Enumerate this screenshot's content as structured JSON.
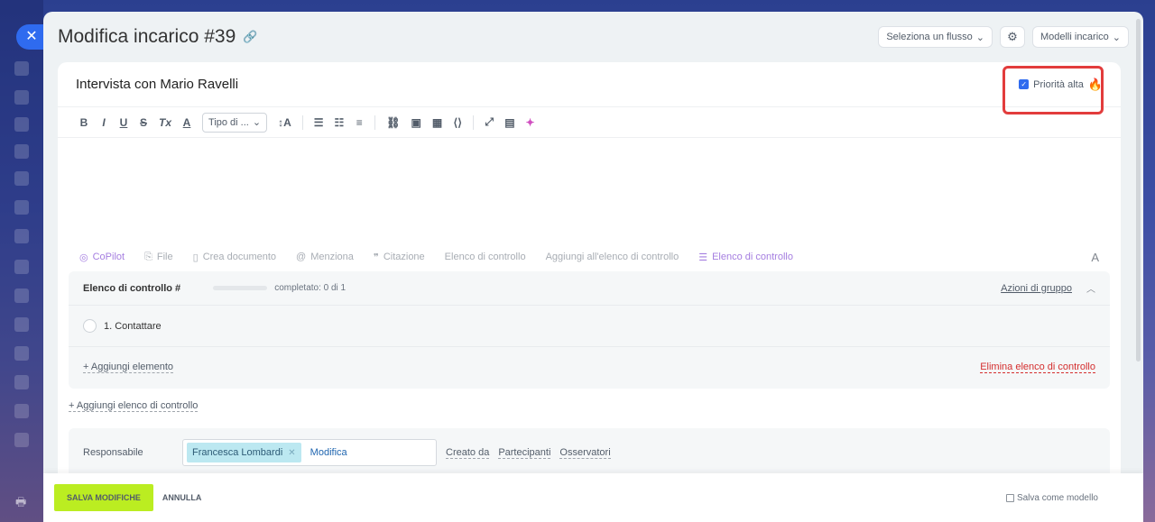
{
  "header": {
    "title": "Modifica incarico #39",
    "flow_select": "Seleziona un flusso",
    "templates_btn": "Modelli incarico"
  },
  "task": {
    "title": "Intervista con Mario Ravelli",
    "priority_label": "Priorità alta",
    "priority_checked": true
  },
  "toolbar": {
    "bold": "B",
    "italic": "I",
    "underline": "U",
    "strike": "S",
    "clear_format": "Tx",
    "color": "A",
    "font_type": "Tipo di ...",
    "font_size": "↕A"
  },
  "actions": {
    "copilot": "CoPilot",
    "file": "File",
    "create_doc": "Crea documento",
    "mention": "Menziona",
    "quote": "Citazione",
    "checklist": "Elenco di controllo",
    "add_to_checklist": "Aggiungi all'elenco di controllo",
    "checklist_active": "Elenco di controllo",
    "font_toggle": "A"
  },
  "checklist": {
    "title": "Elenco di controllo #",
    "progress_text": "completato: 0 di 1",
    "progress_fraction": 0,
    "group_actions": "Azioni di gruppo",
    "items": [
      {
        "label": "1. Contattare"
      }
    ],
    "add_item": "+ Aggiungi elemento",
    "delete": "Elimina elenco di controllo"
  },
  "add_checklist": "+ Aggiungi elenco di controllo",
  "people": {
    "responsible_label": "Responsabile",
    "responsible_name": "Francesca Lombardi",
    "edit": "Modifica",
    "created_by": "Creato da",
    "participants": "Partecipanti",
    "observers": "Osservatori"
  },
  "footer": {
    "save": "SALVA MODIFICHE",
    "cancel": "ANNULLA",
    "save_template": "Salva come modello"
  },
  "colors": {
    "accent": "#2f6bef",
    "save_green": "#bbed21",
    "highlight_red": "#e23c3c",
    "copilot_purple": "#a57ee0"
  }
}
